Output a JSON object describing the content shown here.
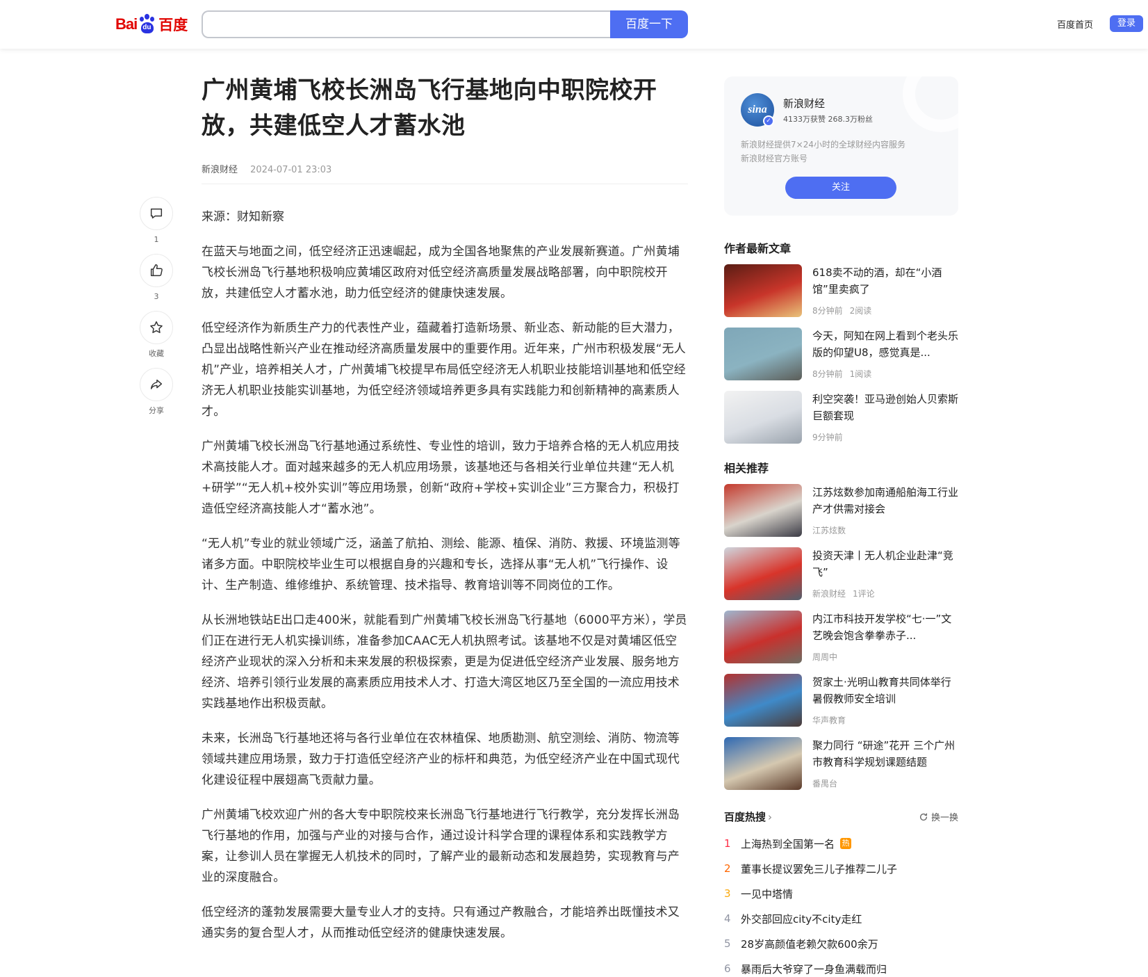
{
  "header": {
    "logo_bai": "Bai",
    "logo_du": "du",
    "logo_cn": "百度",
    "search_placeholder": "",
    "search_button": "百度一下",
    "home_link": "百度首页",
    "login_button": "登录"
  },
  "actions": [
    {
      "icon": "comment-icon",
      "count": "1"
    },
    {
      "icon": "like-icon",
      "count": "3"
    },
    {
      "icon": "star-icon",
      "count": "收藏"
    },
    {
      "icon": "share-icon",
      "count": "分享"
    }
  ],
  "article": {
    "title": "广州黄埔飞校长洲岛飞行基地向中职院校开放，共建低空人才蓄水池",
    "author": "新浪财经",
    "time": "2024-07-01 23:03",
    "source": "来源：财知新察",
    "paragraphs": [
      "在蓝天与地面之间，低空经济正迅速崛起，成为全国各地聚焦的产业发展新赛道。广州黄埔飞校长洲岛飞行基地积极响应黄埔区政府对低空经济高质量发展战略部署，向中职院校开放，共建低空人才蓄水池，助力低空经济的健康快速发展。",
      "低空经济作为新质生产力的代表性产业，蕴藏着打造新场景、新业态、新动能的巨大潜力，凸显出战略性新兴产业在推动经济高质量发展中的重要作用。近年来，广州市积极发展“无人机”产业，培养相关人才，广州黄埔飞校提早布局低空经济无人机职业技能培训基地和低空经济无人机职业技能实训基地，为低空经济领域培养更多具有实践能力和创新精神的高素质人才。",
      "广州黄埔飞校长洲岛飞行基地通过系统性、专业性的培训，致力于培养合格的无人机应用技术高技能人才。面对越来越多的无人机应用场景，该基地还与各相关行业单位共建“无人机+研学”“无人机+校外实训”等应用场景，创新“政府+学校+实训企业”三方聚合力，积极打造低空经济高技能人才“蓄水池”。",
      "“无人机”专业的就业领域广泛，涵盖了航拍、测绘、能源、植保、消防、救援、环境监测等诸多方面。中职院校毕业生可以根据自身的兴趣和专长，选择从事“无人机”飞行操作、设计、生产制造、维修维护、系统管理、技术指导、教育培训等不同岗位的工作。",
      "从长洲地铁站E出口走400米，就能看到广州黄埔飞校长洲岛飞行基地（6000平方米），学员们正在进行无人机实操训练，准备参加CAAC无人机执照考试。该基地不仅是对黄埔区低空经济产业现状的深入分析和未来发展的积极探索，更是为促进低空经济产业发展、服务地方经济、培养引领行业发展的高素质应用技术人才、打造大湾区地区乃至全国的一流应用技术实践基地作出积极贡献。",
      "未来，长洲岛飞行基地还将与各行业单位在农林植保、地质勘测、航空测绘、消防、物流等领域共建应用场景，致力于打造低空经济产业的标杆和典范，为低空经济产业在中国式现代化建设征程中展翅高飞贡献力量。",
      "广州黄埔飞校欢迎广州的各大专中职院校来长洲岛飞行基地进行飞行教学，充分发挥长洲岛飞行基地的作用，加强与产业的对接与合作，通过设计科学合理的课程体系和实践教学方案，让参训人员在掌握无人机技术的同时，了解产业的最新动态和发展趋势，实现教育与产业的深度融合。",
      "低空经济的蓬勃发展需要大量专业人才的支持。只有通过产教融合，才能培养出既懂技术又通实务的复合型人才，从而推动低空经济的健康快速发展。"
    ]
  },
  "author_card": {
    "avatar_text": "sina",
    "name": "新浪财经",
    "stats": "4133万获赞 268.3万粉丝",
    "desc1": "新浪财经提供7×24小时的全球财经内容服务",
    "desc2": "新浪财经官方账号",
    "follow": "关注"
  },
  "latest": {
    "title": "作者最新文章",
    "items": [
      {
        "title": "618卖不动的酒，却在“小酒馆”里卖疯了",
        "meta1": "8分钟前",
        "meta2": "2阅读",
        "colors": [
          "#5a1d14",
          "#c8352a",
          "#e9c37a"
        ]
      },
      {
        "title": "今天，阿知在网上看到个老头乐版的仰望U8，感觉真是...",
        "meta1": "8分钟前",
        "meta2": "1阅读",
        "colors": [
          "#7fa7b8",
          "#8bb3c1",
          "#5b5d58"
        ]
      },
      {
        "title": "利空突袭！亚马逊创始人贝索斯巨额套现",
        "meta1": "9分钟前",
        "meta2": "",
        "colors": [
          "#f2f2f2",
          "#d9dde3",
          "#9aa3ad"
        ]
      }
    ]
  },
  "related": {
    "title": "相关推荐",
    "items": [
      {
        "title": "江苏炫数参加南通船舶海工行业产才供需对接会",
        "meta1": "江苏炫数",
        "meta2": "",
        "colors": [
          "#c43a2d",
          "#d9d4cc",
          "#3b3b45"
        ]
      },
      {
        "title": "投资天津丨无人机企业赴津“竞飞”",
        "meta1": "新浪财经",
        "meta2": "1评论",
        "colors": [
          "#cfd6de",
          "#d8342a",
          "#53606d"
        ]
      },
      {
        "title": "内江市科技开发学校“七·一”文艺晚会饱含拳拳赤子...",
        "meta1": "周周中",
        "meta2": "",
        "colors": [
          "#9fb6cf",
          "#c9302c",
          "#6d6d63"
        ]
      },
      {
        "title": "贺家土·光明山教育共同体举行暑假教师安全培训",
        "meta1": "华声教育",
        "meta2": "",
        "colors": [
          "#b3322f",
          "#3f8ac9",
          "#4b3a36"
        ]
      },
      {
        "title": "聚力同行 “研途”花开 三个广州市教育科学规划课题结题",
        "meta1": "番禺台",
        "meta2": "",
        "colors": [
          "#2f69b3",
          "#d5c8b0",
          "#5b3b2a"
        ]
      }
    ]
  },
  "hot": {
    "title": "百度热搜",
    "chevron": "›",
    "refresh": "换一换",
    "badge": "热",
    "items": [
      {
        "rank": "1",
        "text": "上海热到全国第一名"
      },
      {
        "rank": "2",
        "text": "董事长提议罢免三儿子推荐二儿子"
      },
      {
        "rank": "3",
        "text": "一见中塔情"
      },
      {
        "rank": "4",
        "text": "外交部回应city不city走红"
      },
      {
        "rank": "5",
        "text": "28岁高颜值老赖欠款600余万"
      },
      {
        "rank": "6",
        "text": "暴雨后大爷穿了一身鱼满载而归"
      }
    ]
  }
}
